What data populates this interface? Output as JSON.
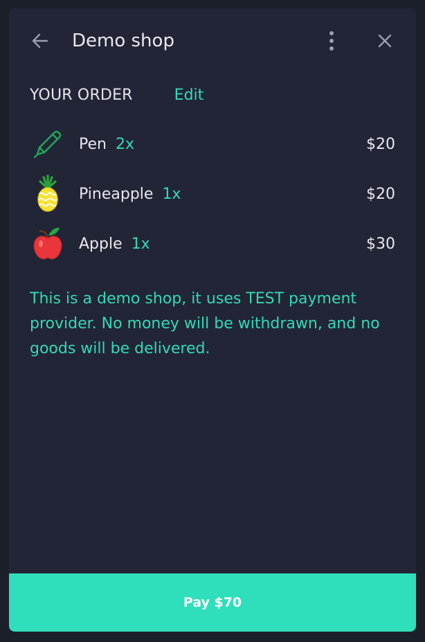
{
  "header": {
    "title": "Demo shop",
    "back_icon": "arrow-left-icon",
    "more_icon": "vertical-dots-icon",
    "close_icon": "close-icon"
  },
  "order": {
    "title": "YOUR ORDER",
    "edit_label": "Edit",
    "items": [
      {
        "name": "Pen",
        "qty": "2x",
        "price": "$20",
        "icon": "pen-icon"
      },
      {
        "name": "Pineapple",
        "qty": "1x",
        "price": "$20",
        "icon": "pineapple-icon"
      },
      {
        "name": "Apple",
        "qty": "1x",
        "price": "$30",
        "icon": "apple-icon"
      }
    ]
  },
  "notice": "This is a demo shop, it uses TEST payment provider. No money will be withdrawn, and no goods will be delivered.",
  "pay_button": {
    "label": "Pay $70"
  },
  "colors": {
    "background": "#1b1f2a",
    "panel": "#212536",
    "accent": "#34d9b7",
    "pay_button": "#2fdfbb",
    "text": "#e7e9ee"
  }
}
